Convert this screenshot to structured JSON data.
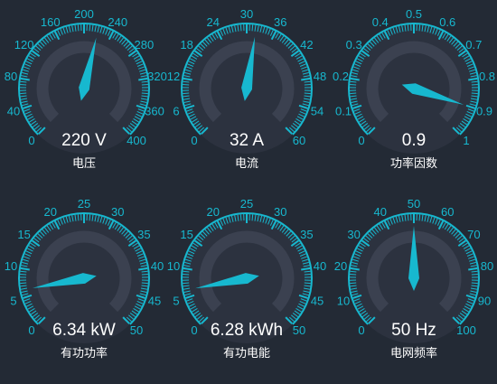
{
  "theme": {
    "background": "#232a35",
    "accent": "#17b8cf",
    "track": "#3b4150",
    "face": "#2c323f",
    "value_text": "#ffffff",
    "label_text": "#ffffff"
  },
  "gauges": [
    {
      "id": "voltage",
      "value_text": "220 V",
      "label": "电压",
      "value": 220,
      "min": 0,
      "max": 400,
      "ticks": [
        "0",
        "40",
        "80",
        "120",
        "160",
        "200",
        "240",
        "280",
        "320",
        "360",
        "400"
      ]
    },
    {
      "id": "current",
      "value_text": "32 A",
      "label": "电流",
      "value": 32,
      "min": 0,
      "max": 60,
      "ticks": [
        "0",
        "6",
        "12",
        "18",
        "24",
        "30",
        "36",
        "42",
        "48",
        "54",
        "60"
      ]
    },
    {
      "id": "power-factor",
      "value_text": "0.9",
      "label": "功率因数",
      "value": 0.9,
      "min": 0,
      "max": 1,
      "ticks": [
        "0",
        "0.1",
        "0.2",
        "0.3",
        "0.4",
        "0.5",
        "0.6",
        "0.7",
        "0.8",
        "0.9",
        "1"
      ]
    },
    {
      "id": "active-power",
      "value_text": "6.34 kW",
      "label": "有功功率",
      "value": 6.34,
      "min": 0,
      "max": 50,
      "ticks": [
        "0",
        "5",
        "10",
        "15",
        "20",
        "25",
        "30",
        "35",
        "40",
        "45",
        "50"
      ]
    },
    {
      "id": "active-energy",
      "value_text": "6.28 kWh",
      "label": "有功电能",
      "value": 6.28,
      "min": 0,
      "max": 50,
      "ticks": [
        "0",
        "5",
        "10",
        "15",
        "20",
        "25",
        "30",
        "35",
        "40",
        "45",
        "50"
      ]
    },
    {
      "id": "frequency",
      "value_text": "50 Hz",
      "label": "电网频率",
      "value": 50,
      "min": 0,
      "max": 100,
      "ticks": [
        "0",
        "10",
        "20",
        "30",
        "40",
        "50",
        "60",
        "70",
        "80",
        "90",
        "100"
      ]
    }
  ]
}
